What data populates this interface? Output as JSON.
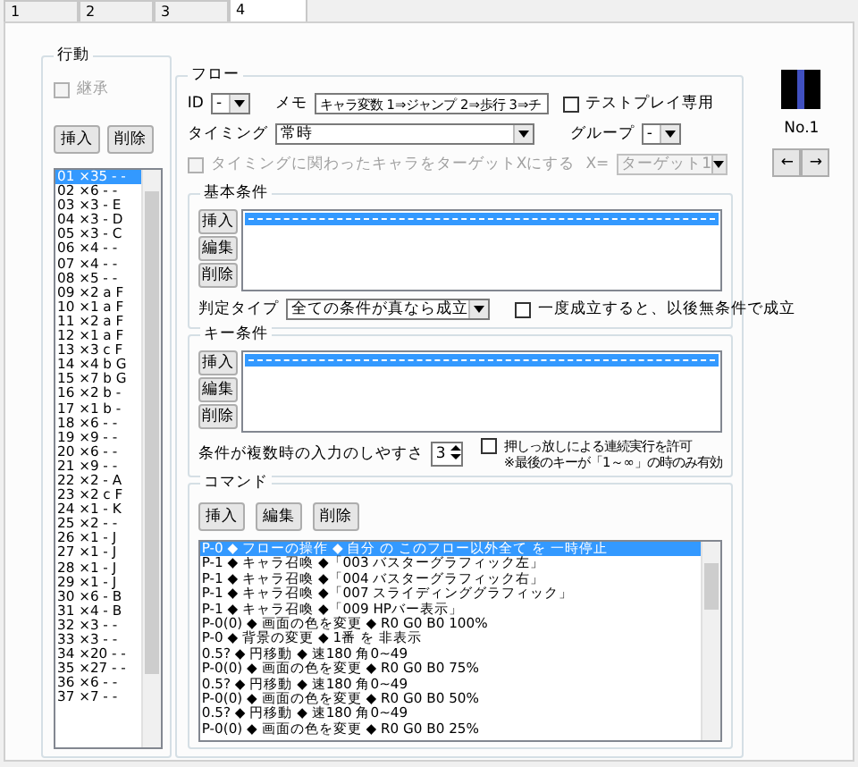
{
  "tabs": [
    {
      "label": "1",
      "selected": false
    },
    {
      "label": "2",
      "selected": false
    },
    {
      "label": "3",
      "selected": false
    },
    {
      "label": "4",
      "selected": true
    }
  ],
  "action": {
    "title": "行動",
    "inherit": {
      "label": "継承",
      "checked": false,
      "disabled": true
    },
    "buttons": [
      "挿入",
      "削除"
    ],
    "items": [
      {
        "label": "01 ×35 - -",
        "selected": true
      },
      {
        "label": "02 ×6 - -",
        "selected": false
      },
      {
        "label": "03 ×3 - E",
        "selected": false
      },
      {
        "label": "04 ×3 - D",
        "selected": false
      },
      {
        "label": "05 ×3 - C",
        "selected": false
      },
      {
        "label": "06 ×4 - -",
        "selected": false
      },
      {
        "label": "07 ×4 - -",
        "selected": false
      },
      {
        "label": "08 ×5 - -",
        "selected": false
      },
      {
        "label": "09 ×2 a F",
        "selected": false
      },
      {
        "label": "10 ×1 a F",
        "selected": false
      },
      {
        "label": "11 ×2 a F",
        "selected": false
      },
      {
        "label": "12 ×1 a F",
        "selected": false
      },
      {
        "label": "13 ×3 c F",
        "selected": false
      },
      {
        "label": "14 ×4 b G",
        "selected": false
      },
      {
        "label": "15 ×7 b G",
        "selected": false
      },
      {
        "label": "16 ×2 b -",
        "selected": false
      },
      {
        "label": "17 ×1 b -",
        "selected": false
      },
      {
        "label": "18 ×6 - -",
        "selected": false
      },
      {
        "label": "19 ×9 - -",
        "selected": false
      },
      {
        "label": "20 ×6 - -",
        "selected": false
      },
      {
        "label": "21 ×9 - -",
        "selected": false
      },
      {
        "label": "22 ×2 - A",
        "selected": false
      },
      {
        "label": "23 ×2 c F",
        "selected": false
      },
      {
        "label": "24 ×1 - K",
        "selected": false
      },
      {
        "label": "25 ×2 - -",
        "selected": false
      },
      {
        "label": "26 ×1 - J",
        "selected": false
      },
      {
        "label": "27 ×1 - J",
        "selected": false
      },
      {
        "label": "28 ×1 - J",
        "selected": false
      },
      {
        "label": "29 ×1 - J",
        "selected": false
      },
      {
        "label": "30 ×6 - B",
        "selected": false
      },
      {
        "label": "31 ×4 - B",
        "selected": false
      },
      {
        "label": "32 ×3 - -",
        "selected": false
      },
      {
        "label": "33 ×3 - -",
        "selected": false
      },
      {
        "label": "34 ×20 - -",
        "selected": false
      },
      {
        "label": "35 ×27 - -",
        "selected": false
      },
      {
        "label": "36 ×6 - -",
        "selected": false
      },
      {
        "label": "37 ×7 - -",
        "selected": false
      }
    ]
  },
  "flow": {
    "title": "フロー",
    "id": {
      "label": "ID",
      "value": "-"
    },
    "memo": {
      "label": "メモ",
      "value": "キャラ変数 1⇒ジャンプ 2⇒歩行 3⇒チ"
    },
    "test_play": {
      "label": "テストプレイ専用",
      "checked": false
    },
    "timing": {
      "label": "タイミング",
      "value": "常時"
    },
    "group": {
      "label": "グループ",
      "value": "-"
    },
    "target_check": {
      "label": "タイミングに関わったキャラをターゲットXにする",
      "checked": false,
      "disabled": true
    },
    "target_x": {
      "label": "X=",
      "value": "ターゲット1",
      "disabled": true
    },
    "basic": {
      "title": "基本条件",
      "buttons": [
        "挿入",
        "編集",
        "削除"
      ],
      "rows": [
        {
          "kind": "separator",
          "selected": true
        }
      ],
      "judge": {
        "label": "判定タイプ",
        "value": "全ての条件が真なら成立"
      },
      "once": {
        "label": "一度成立すると、以後無条件で成立",
        "checked": false
      }
    },
    "key": {
      "title": "キー条件",
      "buttons": [
        "挿入",
        "編集",
        "削除"
      ],
      "rows": [
        {
          "kind": "separator",
          "selected": true
        }
      ],
      "ease": {
        "label": "条件が複数時の入力のしやすさ",
        "value": "3"
      },
      "hold": {
        "label": "押しっ放しによる連続実行を許可",
        "note": "※最後のキーが「1～∞」の時のみ有効",
        "checked": false
      }
    },
    "command": {
      "title": "コマンド",
      "buttons": [
        "挿入",
        "編集",
        "削除"
      ],
      "rows": [
        {
          "text": "P-0 ◆ フローの操作 ◆ 自分 の このフロー以外全て を 一時停止",
          "selected": true
        },
        {
          "text": "P-1 ◆ キャラ召喚 ◆「003 バスターグラフィック左」",
          "selected": false
        },
        {
          "text": "P-1 ◆ キャラ召喚 ◆「004 バスターグラフィック右」",
          "selected": false
        },
        {
          "text": "P-1 ◆ キャラ召喚 ◆「007 スライディンググラフィック」",
          "selected": false
        },
        {
          "text": "P-1 ◆ キャラ召喚 ◆「009 HPバー表示」",
          "selected": false
        },
        {
          "text": "P-0(0) ◆ 画面の色を変更 ◆ R0 G0 B0 100%",
          "selected": false
        },
        {
          "text": "P-0 ◆ 背景の変更 ◆ 1番 を 非表示",
          "selected": false
        },
        {
          "text": "0.5? ◆ 円移動 ◆ 速180 角0~49",
          "selected": false
        },
        {
          "text": "P-0(0) ◆ 画面の色を変更 ◆ R0 G0 B0 75%",
          "selected": false
        },
        {
          "text": "0.5? ◆ 円移動 ◆ 速180 角0~49",
          "selected": false
        },
        {
          "text": "P-0(0) ◆ 画面の色を変更 ◆ R0 G0 B0 50%",
          "selected": false
        },
        {
          "text": "0.5? ◆ 円移動 ◆ 速180 角0~49",
          "selected": false
        },
        {
          "text": "P-0(0) ◆ 画面の色を変更 ◆ R0 G0 B0 25%",
          "selected": false
        }
      ]
    }
  },
  "preview": {
    "label": "No.1",
    "buttons": [
      "←",
      "→"
    ]
  }
}
